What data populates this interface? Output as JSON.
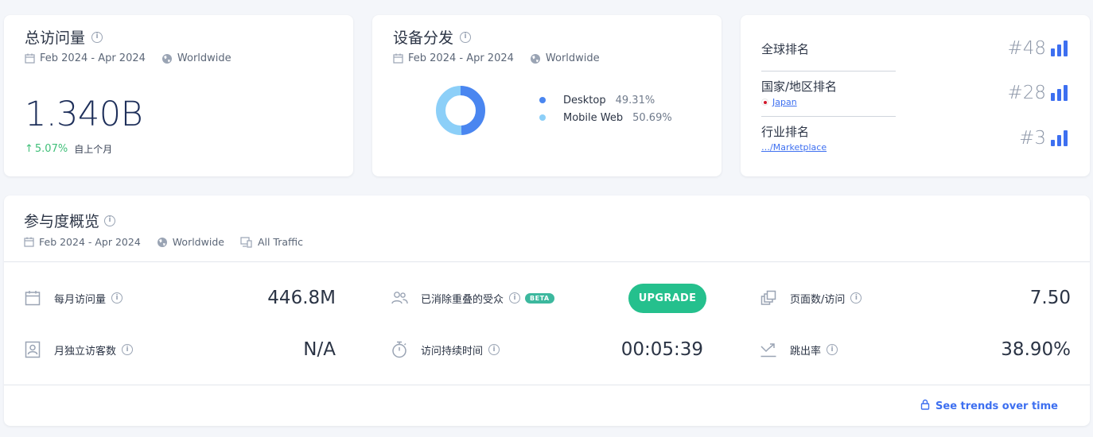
{
  "visits_card": {
    "title": "总访问量",
    "date_range": "Feb 2024 - Apr 2024",
    "region": "Worldwide",
    "value": "1.340B",
    "change_pct": "5.07%",
    "change_label": "自上个月",
    "change_color": "#3fbf78"
  },
  "device_card": {
    "title": "设备分发",
    "date_range": "Feb 2024 - Apr 2024",
    "region": "Worldwide",
    "legend": [
      {
        "name": "Desktop",
        "pct": "49.31%",
        "value": 49.31,
        "color": "#4a86f0"
      },
      {
        "name": "Mobile Web",
        "pct": "50.69%",
        "value": 50.69,
        "color": "#8ccff8"
      }
    ]
  },
  "rank_card": {
    "global": {
      "label": "全球排名",
      "value": "#48"
    },
    "country": {
      "label": "国家/地区排名",
      "link": "Japan",
      "value": "#28"
    },
    "industry": {
      "label": "行业排名",
      "link": "…/Marketplace",
      "value": "#3"
    }
  },
  "engagement": {
    "title": "参与度概览",
    "date_range": "Feb 2024 - Apr 2024",
    "region": "Worldwide",
    "traffic": "All Traffic",
    "monthly_visits": {
      "label": "每月访问量",
      "value": "446.8M"
    },
    "unique_visitors": {
      "label": "月独立访客数",
      "value": "N/A"
    },
    "dedup_audience": {
      "label": "已消除重叠的受众",
      "badge": "BETA",
      "button": "UPGRADE"
    },
    "visit_duration": {
      "label": "访问持续时间",
      "value": "00:05:39"
    },
    "pages_per_visit": {
      "label": "页面数/访问",
      "value": "7.50"
    },
    "bounce_rate": {
      "label": "跳出率",
      "value": "38.90%"
    },
    "trends_link": "See trends over time"
  }
}
